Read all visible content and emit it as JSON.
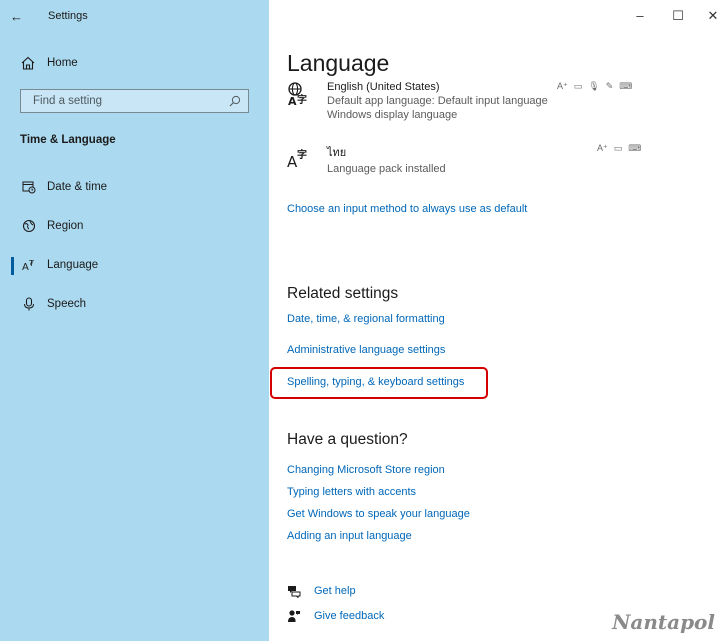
{
  "window": {
    "title": "Settings",
    "back_icon": "back-arrow-icon",
    "minimize": "–",
    "maximize": "☐",
    "close": "✕"
  },
  "sidebar": {
    "home": "Home",
    "search_placeholder": "Find a setting",
    "section": "Time & Language",
    "items": [
      {
        "label": "Date & time",
        "icon": "calendar-clock-icon"
      },
      {
        "label": "Region",
        "icon": "globe-region-icon"
      },
      {
        "label": "Language",
        "icon": "language-icon",
        "active": true
      },
      {
        "label": "Speech",
        "icon": "microphone-icon"
      }
    ]
  },
  "main": {
    "title": "Language",
    "languages": [
      {
        "name": "English (United States)",
        "desc1": "Default app language: Default input language",
        "desc2": "Windows display language",
        "features": [
          "A⁺",
          "▭",
          "🎙",
          "✎",
          "⌨"
        ]
      },
      {
        "name": "ไทย",
        "desc1": "Language pack installed",
        "features": [
          "A⁺",
          "▭",
          "⌨"
        ]
      }
    ],
    "input_method_link": "Choose an input method to always use as default",
    "related": {
      "title": "Related settings",
      "links": [
        "Date, time, & regional formatting",
        "Administrative language settings",
        "Spelling, typing, & keyboard settings"
      ]
    },
    "question": {
      "title": "Have a question?",
      "links": [
        "Changing Microsoft Store region",
        "Typing letters with accents",
        "Get Windows to speak your language",
        "Adding an input language"
      ]
    },
    "help": {
      "get_help": "Get help",
      "feedback": "Give feedback"
    }
  },
  "watermark": "Nantapol",
  "colors": {
    "sidebar_bg": "#abd9ef",
    "link": "#0067b8",
    "highlight": "#d40000",
    "accent": "#005a9e"
  }
}
